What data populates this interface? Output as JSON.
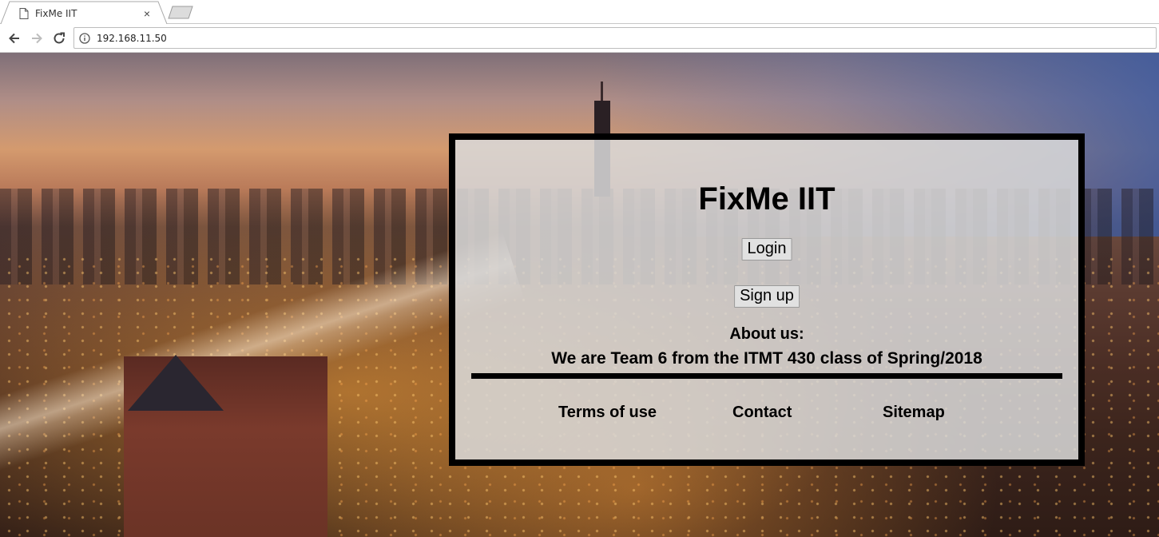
{
  "browser": {
    "tab": {
      "title": "FixMe IIT",
      "close_glyph": "×"
    },
    "url": "192.168.11.50"
  },
  "page": {
    "title": "FixMe IIT",
    "login_label": "Login",
    "signup_label": "Sign up",
    "about_heading": "About us:",
    "about_text": "We are Team 6 from the ITMT 430 class of Spring/2018",
    "footer": {
      "terms": "Terms of use",
      "contact": "Contact",
      "sitemap": "Sitemap"
    }
  },
  "colors": {
    "card_bg": "#dadada",
    "card_border": "#000000",
    "text": "#000000"
  },
  "icons": [
    "page-icon",
    "close-icon",
    "new-tab-icon",
    "back-icon",
    "forward-icon",
    "reload-icon",
    "info-icon"
  ]
}
